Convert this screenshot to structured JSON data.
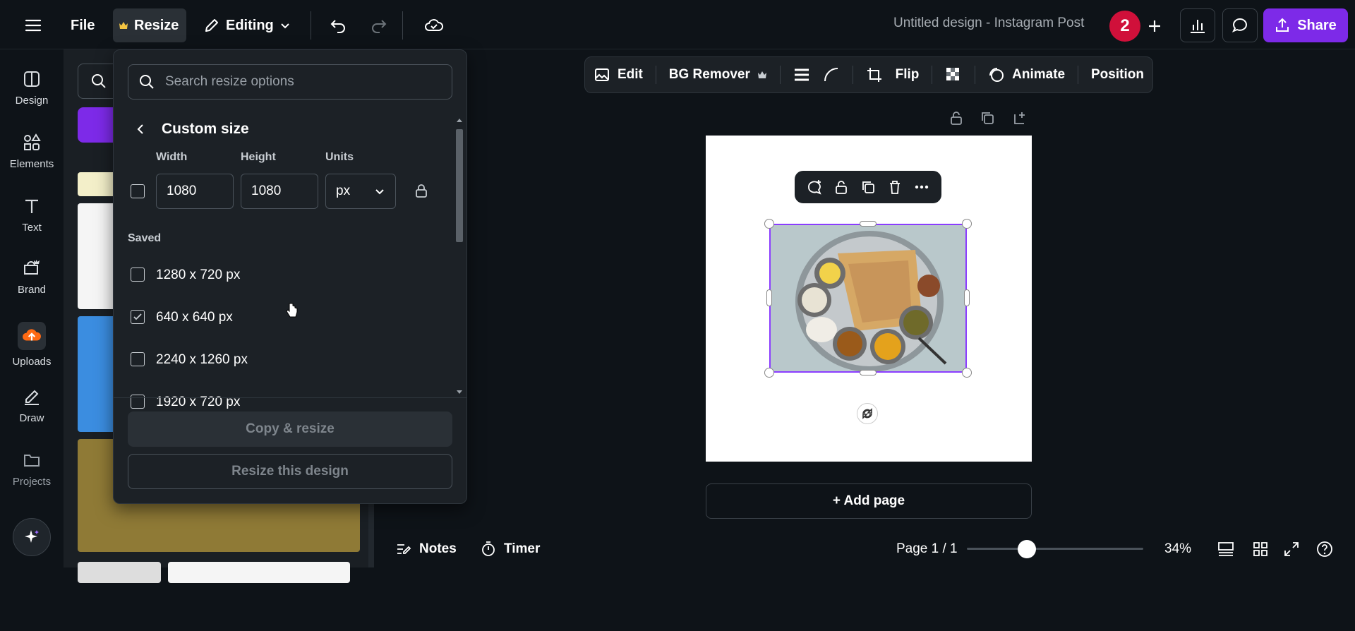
{
  "topbar": {
    "file_label": "File",
    "resize_label": "Resize",
    "editing_label": "Editing",
    "title": "Untitled design - Instagram Post",
    "avatar_text": "2",
    "share_label": "Share"
  },
  "rail": {
    "items": [
      {
        "label": "Design",
        "icon": "design-icon"
      },
      {
        "label": "Elements",
        "icon": "elements-icon"
      },
      {
        "label": "Text",
        "icon": "text-icon"
      },
      {
        "label": "Brand",
        "icon": "brand-icon"
      },
      {
        "label": "Uploads",
        "icon": "upload-icon"
      },
      {
        "label": "Draw",
        "icon": "draw-icon"
      },
      {
        "label": "Projects",
        "icon": "folder-icon"
      }
    ]
  },
  "context_toolbar": {
    "edit_label": "Edit",
    "bg_remover_label": "BG Remover",
    "flip_label": "Flip",
    "animate_label": "Animate",
    "position_label": "Position"
  },
  "resize_panel": {
    "search_placeholder": "Search resize options",
    "back_title": "Custom size",
    "width_label": "Width",
    "height_label": "Height",
    "units_label": "Units",
    "width_value": "1080",
    "height_value": "1080",
    "units_value": "px",
    "saved_heading": "Saved",
    "saved": [
      {
        "label": "1280 x 720 px",
        "checked": false
      },
      {
        "label": "640 x 640 px",
        "checked": true
      },
      {
        "label": "2240 x 1260 px",
        "checked": false
      },
      {
        "label": "1920 x 720 px",
        "checked": false
      }
    ],
    "copy_resize_label": "Copy & resize",
    "resize_design_label": "Resize this design"
  },
  "canvas": {
    "add_page_label": "+ Add page"
  },
  "bottombar": {
    "notes_label": "Notes",
    "timer_label": "Timer",
    "page_indicator": "Page 1 / 1",
    "zoom": "34%",
    "zoom_fraction": 0.34
  },
  "colors": {
    "accent": "#7d2ae8",
    "selection": "#8b3dff",
    "avatar": "#d0103a",
    "background": "#0e1318"
  }
}
